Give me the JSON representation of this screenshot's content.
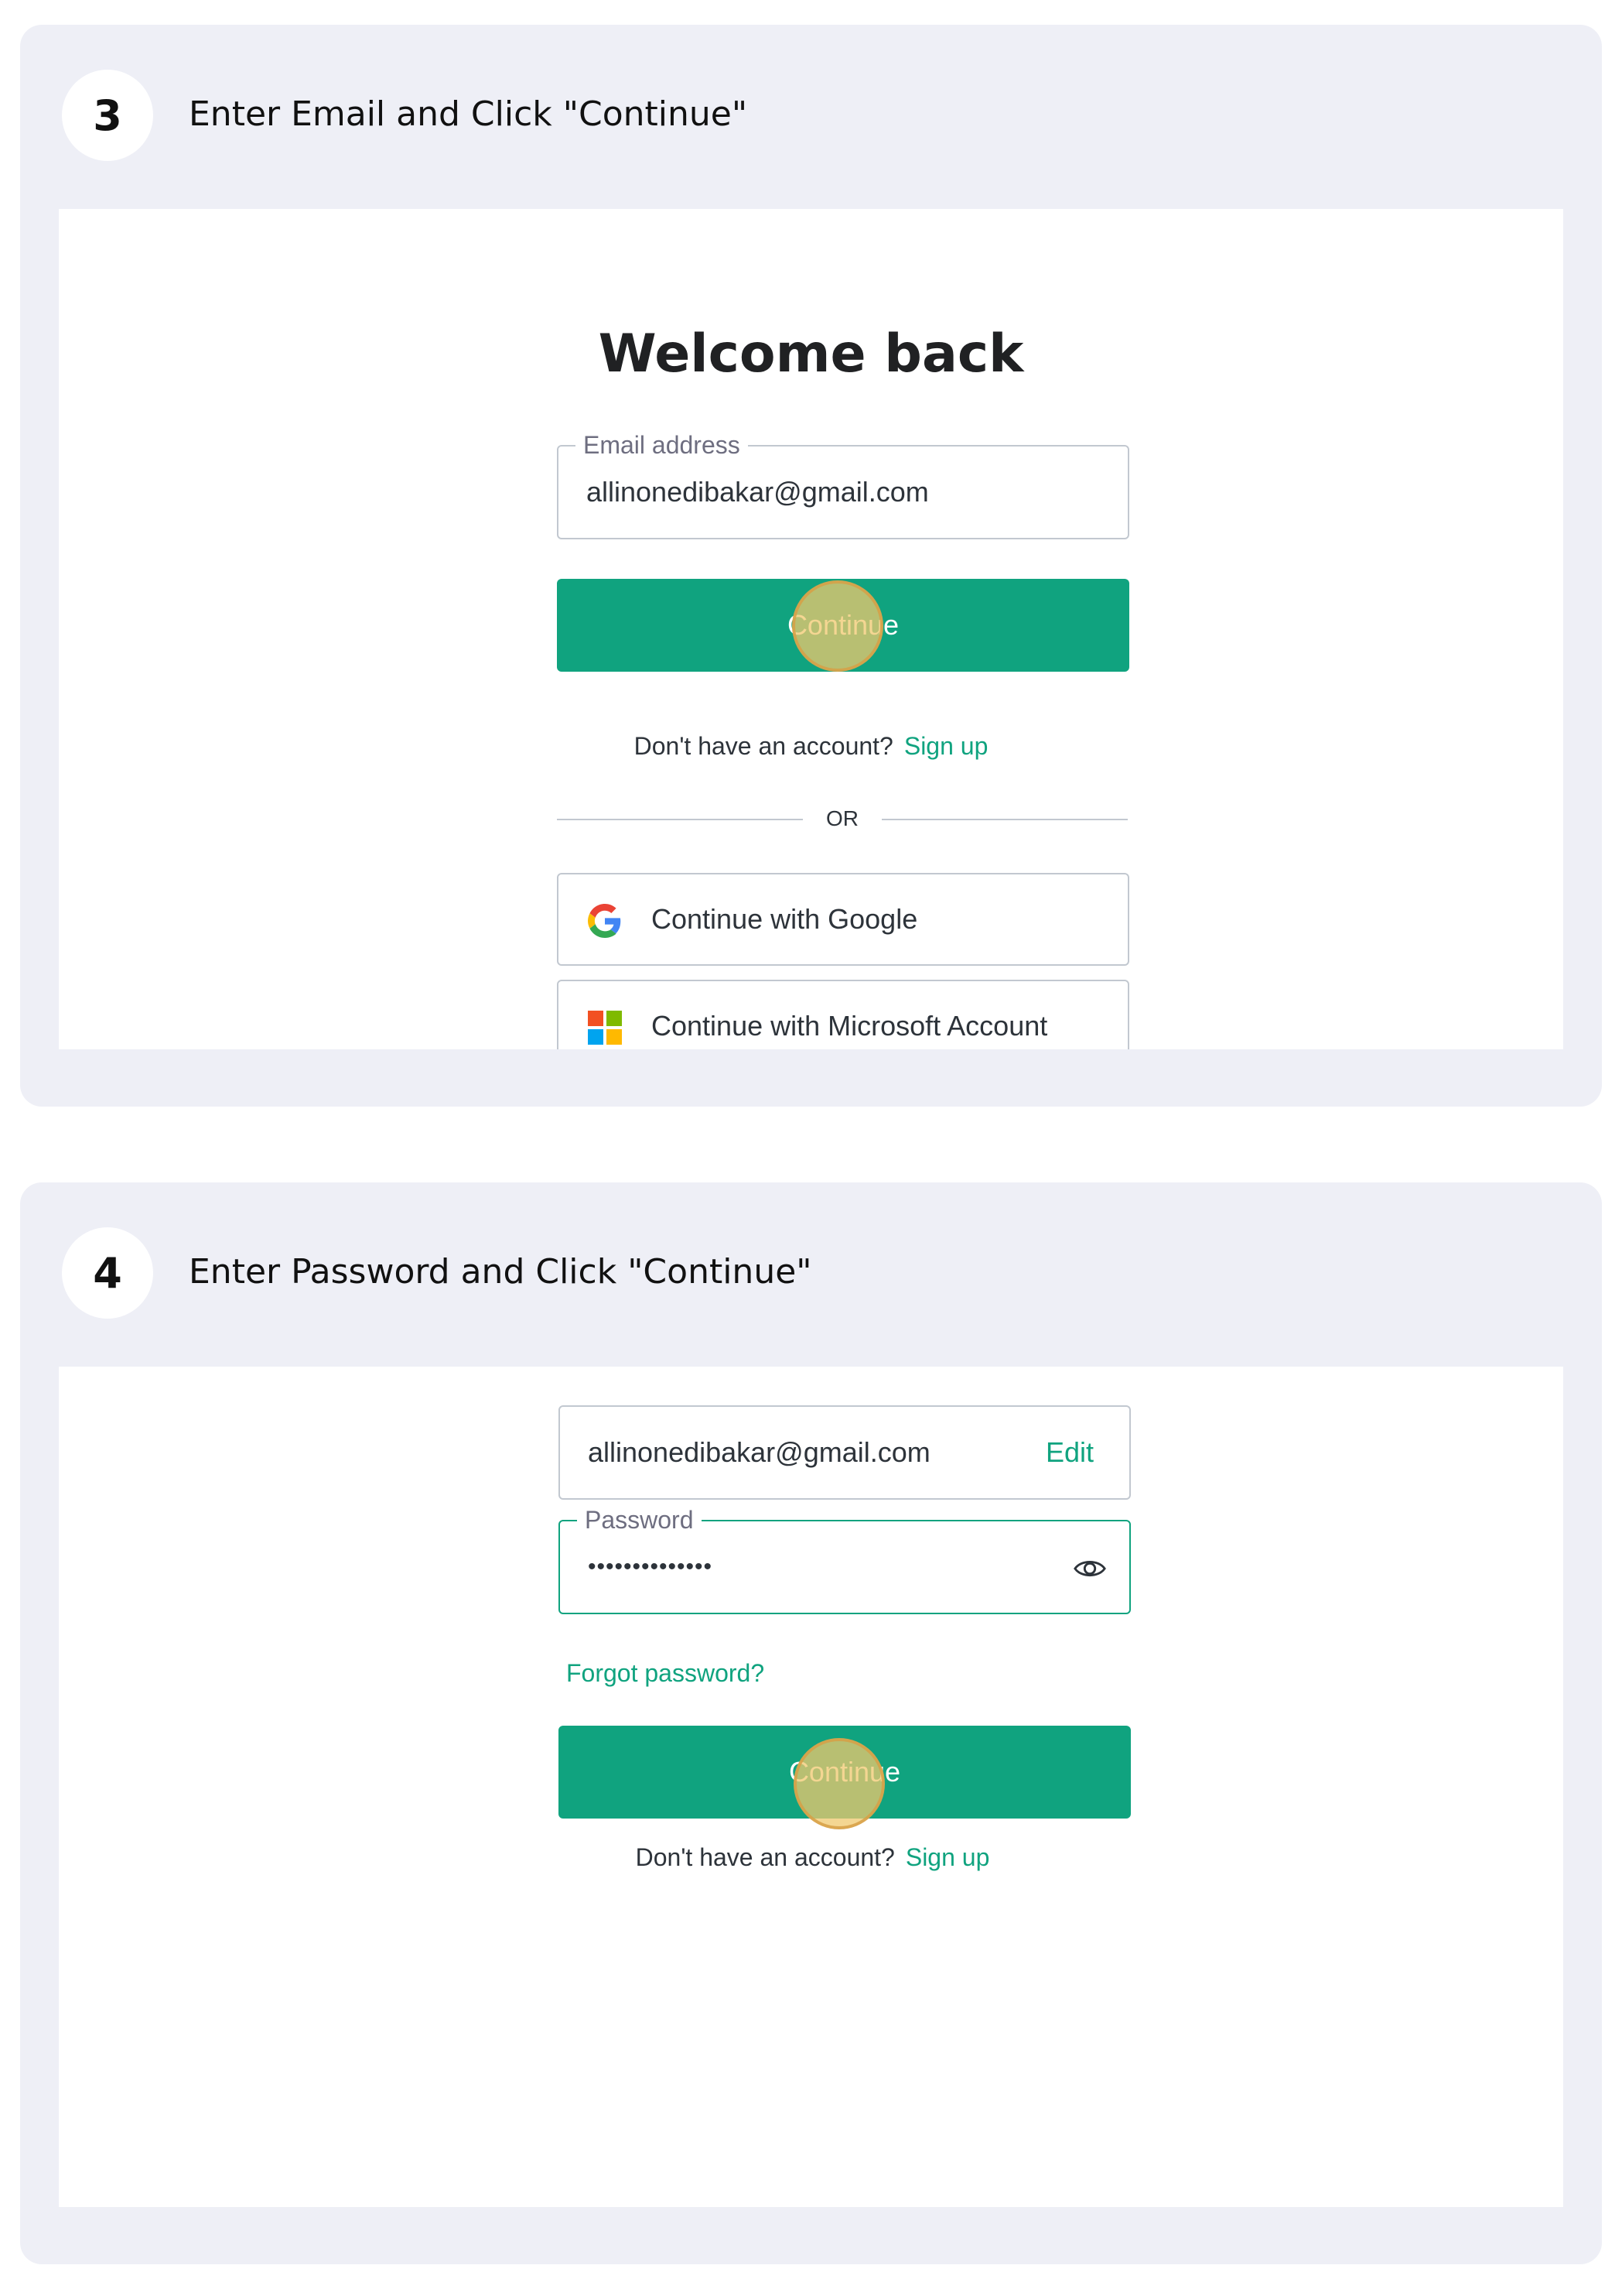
{
  "steps": [
    {
      "number": "3",
      "title": "Enter Email and Click \"Continue\"",
      "screen": {
        "heading": "Welcome back",
        "email_legend": "Email address",
        "email_value": "allinonedibakar@gmail.com",
        "continue_label": "Continue",
        "no_account_text": "Don't have an account?",
        "signup_label": "Sign up",
        "or_label": "OR",
        "google_label": "Continue with Google",
        "microsoft_label": "Continue with Microsoft Account"
      }
    },
    {
      "number": "4",
      "title": "Enter Password and Click \"Continue\"",
      "screen": {
        "email_value": "allinonedibakar@gmail.com",
        "edit_label": "Edit",
        "password_legend": "Password",
        "password_value": "••••••••••••••",
        "forgot_label": "Forgot password?",
        "continue_label": "Continue",
        "no_account_text": "Don't have an account?",
        "signup_label": "Sign up"
      }
    }
  ],
  "colors": {
    "card_background": "#eeeff6",
    "primary_green": "#10a37f",
    "click_marker": "#f0c86e",
    "google_blue": "#4285f4",
    "google_red": "#ea4335",
    "google_yellow": "#fbbc05",
    "google_green": "#34a853",
    "ms_red": "#f25022",
    "ms_green": "#7fba00",
    "ms_blue": "#00a4ef",
    "ms_yellow": "#ffb900"
  },
  "icons": [
    "google-logo-icon",
    "microsoft-logo-icon",
    "eye-icon"
  ]
}
